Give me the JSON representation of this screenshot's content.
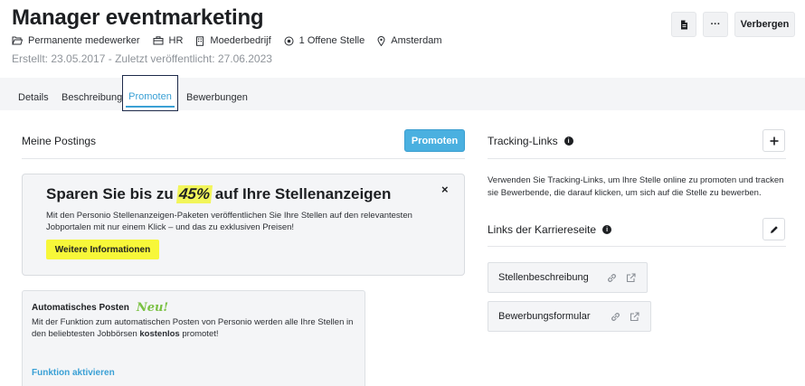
{
  "header": {
    "title": "Manager eventmarketing",
    "meta": {
      "employment": "Permanente medewerker",
      "department": "HR",
      "company": "Moederbedrijf",
      "openings": "1 Offene Stelle",
      "location": "Amsterdam"
    },
    "dates": "Erstellt: 23.05.2017 - Zuletzt veröffentlicht: 27.06.2023",
    "hide_label": "Verbergen",
    "more_label": "···"
  },
  "tabs": [
    {
      "label": "Details"
    },
    {
      "label": "Beschreibung"
    },
    {
      "label": "Promoten",
      "active": true
    },
    {
      "label": "Bewerbungen"
    }
  ],
  "postings": {
    "title": "Meine Postings",
    "promote_button": "Promoten",
    "promo": {
      "headline_before": "Sparen Sie bis zu",
      "headline_highlight": "45%",
      "headline_after": "auf Ihre Stellenanzeigen",
      "text": "Mit den Personio Stellenanzeigen-Paketen veröffentlichen Sie Ihre Stellen auf den relevantesten Jobportalen mit nur einem Klick – und das zu exklusiven Preisen!",
      "button": "Weitere Informationen",
      "close": "×"
    },
    "auto": {
      "title": "Automatisches Posten",
      "badge": "Neu!",
      "text_before": "Mit der Funktion zum automatischen Posten von Personio werden alle Ihre Stellen in den beliebtesten Jobbörsen ",
      "text_bold": "kostenlos",
      "text_after": " promotet!",
      "link": "Funktion aktivieren"
    }
  },
  "tracking": {
    "title": "Tracking-Links",
    "info": "i",
    "text": "Verwenden Sie Tracking-Links, um Ihre Stelle online zu promoten und tracken sie Bewerbende, die darauf klicken, um sich auf die Stelle zu bewerben.",
    "career_title": "Links der Karriereseite",
    "links": [
      {
        "label": "Stellenbeschreibung"
      },
      {
        "label": "Bewerbungsformular"
      }
    ]
  },
  "colors": {
    "accent": "#3aa0d5",
    "promote_button": "#4ab0e0",
    "highlight_yellow": "#f7f739",
    "neu_green": "#7ac143"
  }
}
